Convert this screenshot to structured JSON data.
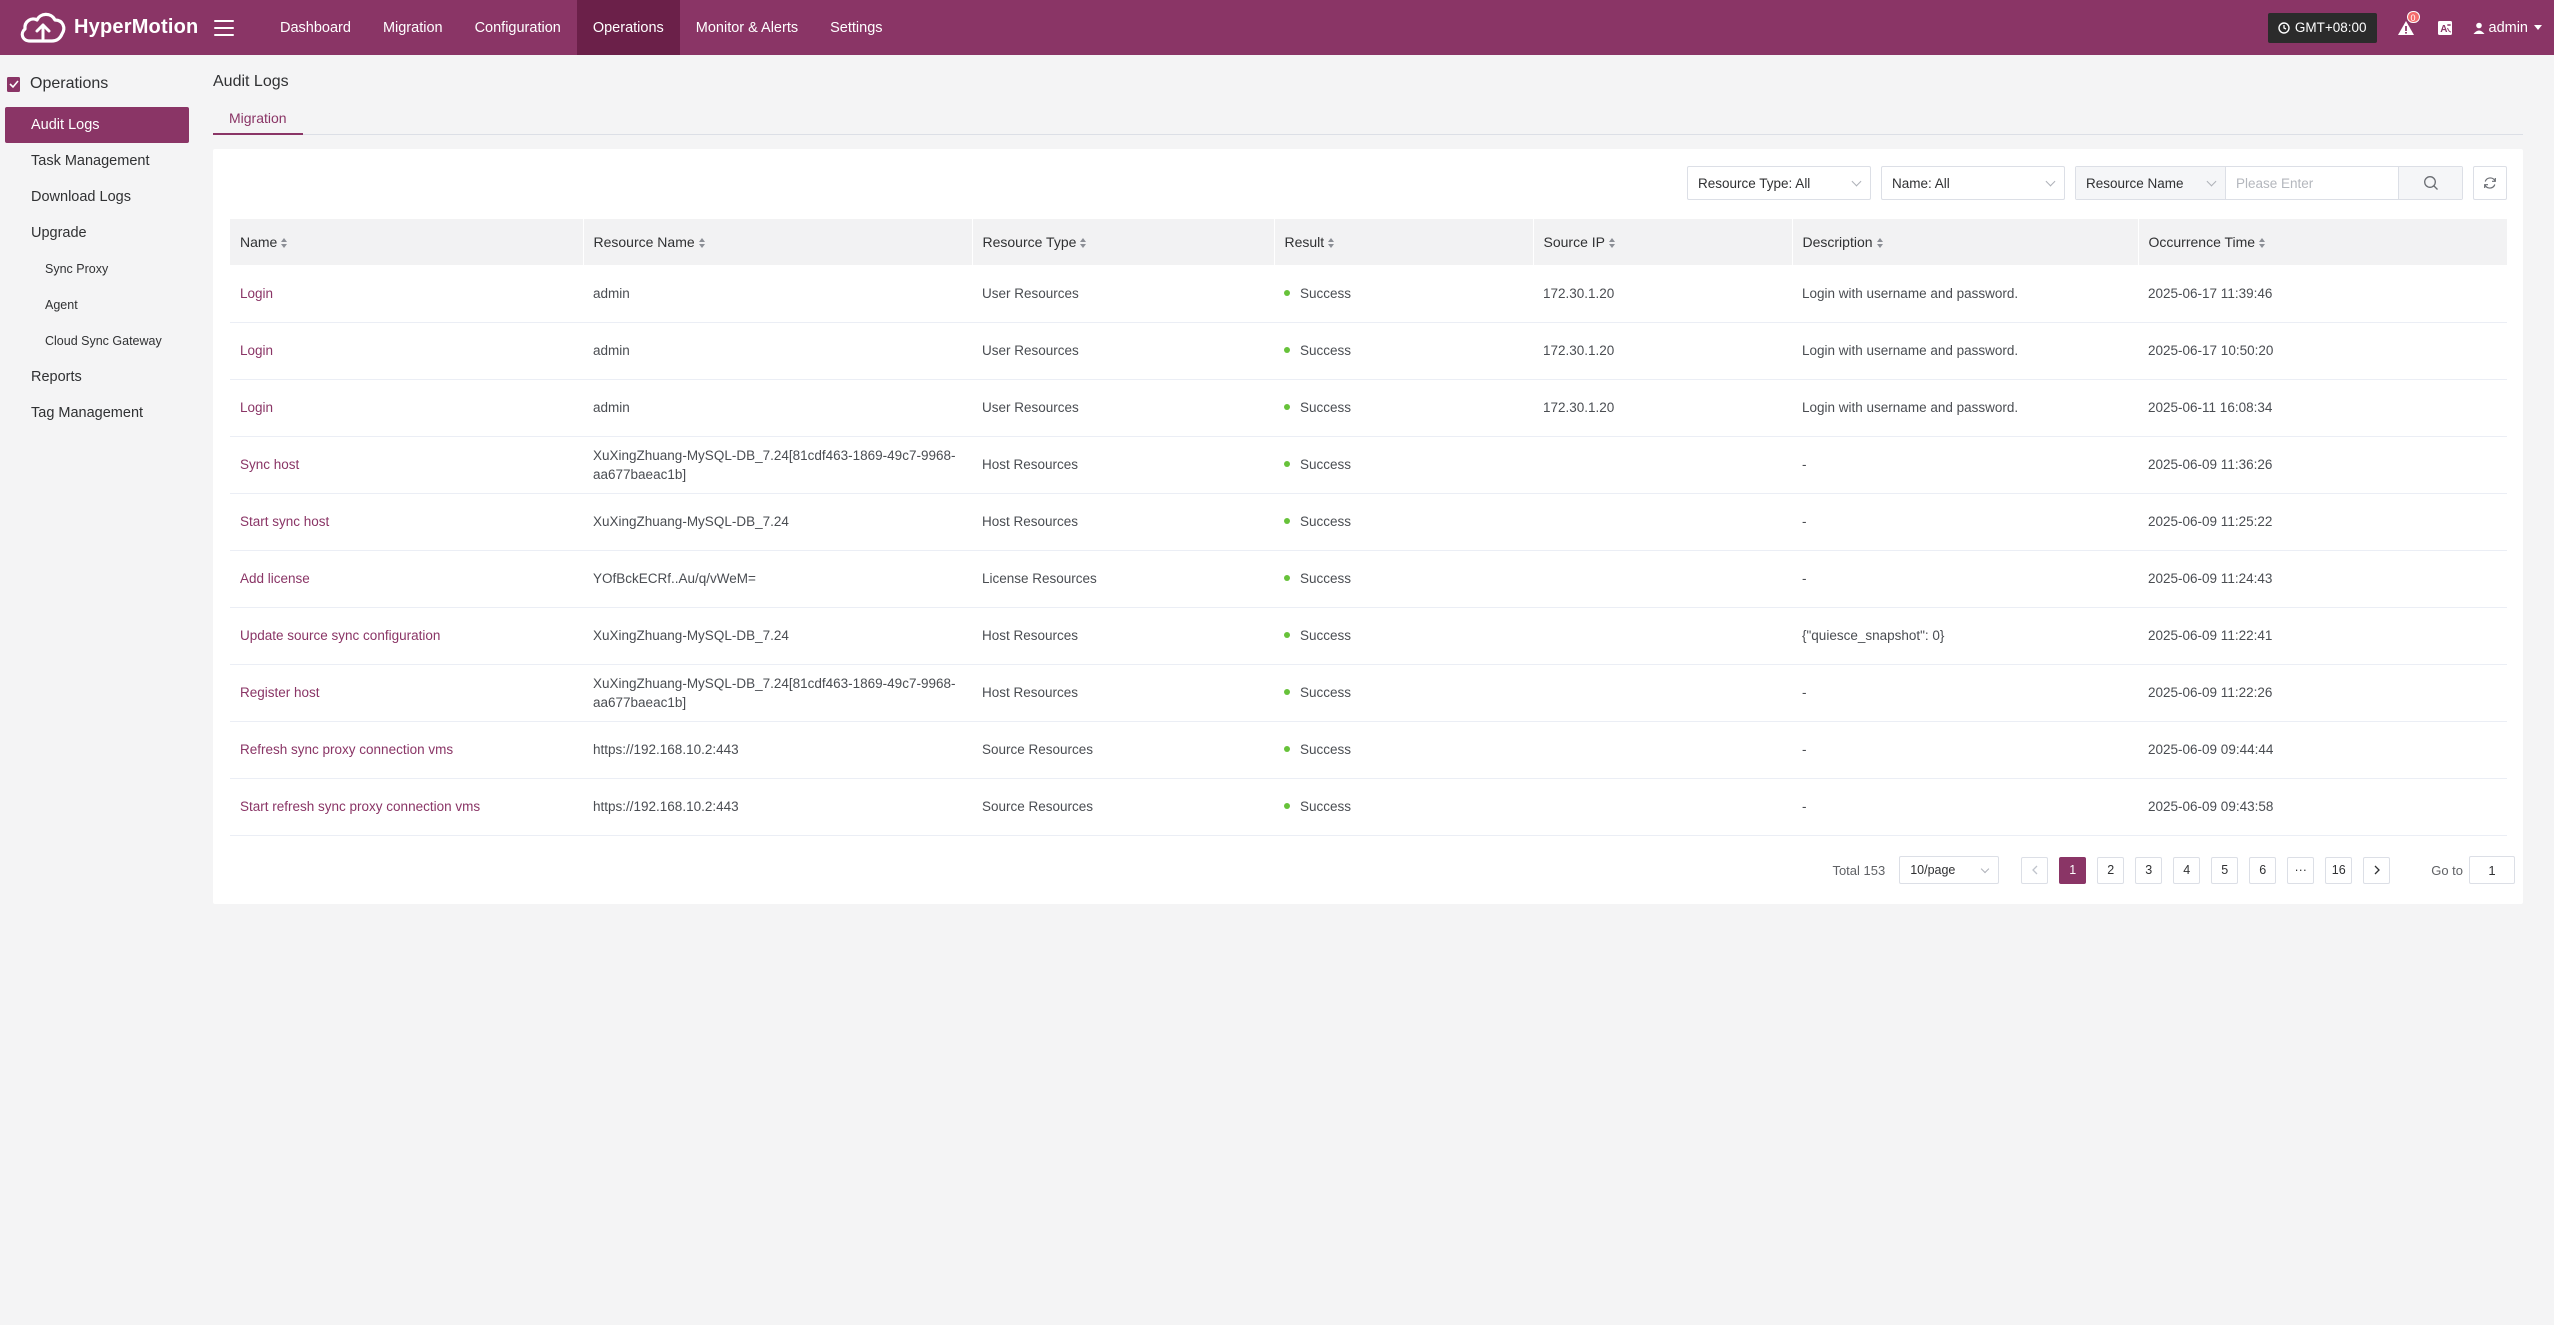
{
  "header": {
    "brand": "HyperMotion",
    "nav": [
      "Dashboard",
      "Migration",
      "Configuration",
      "Operations",
      "Monitor & Alerts",
      "Settings"
    ],
    "active_nav": "Operations",
    "timezone": "GMT+08:00",
    "alert_count": "0",
    "user": "admin",
    "colors": {
      "primary": "#8a3566",
      "active_nav": "#6b2049",
      "success": "#67c23a"
    }
  },
  "sidebar": {
    "title": "Operations",
    "items": [
      {
        "label": "Audit Logs",
        "level": 1,
        "active": true
      },
      {
        "label": "Task Management",
        "level": 1
      },
      {
        "label": "Download Logs",
        "level": 1
      },
      {
        "label": "Upgrade",
        "level": 1
      },
      {
        "label": "Sync Proxy",
        "level": 2
      },
      {
        "label": "Agent",
        "level": 2
      },
      {
        "label": "Cloud Sync Gateway",
        "level": 2
      },
      {
        "label": "Reports",
        "level": 1
      },
      {
        "label": "Tag Management",
        "level": 1
      }
    ]
  },
  "main": {
    "title": "Audit Logs",
    "tabs": [
      "Migration"
    ],
    "filters": {
      "resource_type": "Resource Type: All",
      "name": "Name: All",
      "search_field": "Resource Name",
      "search_placeholder": "Please Enter"
    },
    "table": {
      "columns": [
        "Name",
        "Resource Name",
        "Resource Type",
        "Result",
        "Source IP",
        "Description",
        "Occurrence Time"
      ],
      "rows": [
        [
          "Login",
          "admin",
          "User Resources",
          "Success",
          "172.30.1.20",
          "Login with username and password.",
          "2025-06-17 11:39:46"
        ],
        [
          "Login",
          "admin",
          "User Resources",
          "Success",
          "172.30.1.20",
          "Login with username and password.",
          "2025-06-17 10:50:20"
        ],
        [
          "Login",
          "admin",
          "User Resources",
          "Success",
          "172.30.1.20",
          "Login with username and password.",
          "2025-06-11 16:08:34"
        ],
        [
          "Sync host",
          "XuXingZhuang-MySQL-DB_7.24[81cdf463-1869-49c7-9968-aa677baeac1b]",
          "Host Resources",
          "Success",
          "",
          "-",
          "2025-06-09 11:36:26"
        ],
        [
          "Start sync host",
          "XuXingZhuang-MySQL-DB_7.24",
          "Host Resources",
          "Success",
          "",
          "-",
          "2025-06-09 11:25:22"
        ],
        [
          "Add license",
          "YOfBckECRf..Au/q/vWeM=",
          "License Resources",
          "Success",
          "",
          "-",
          "2025-06-09 11:24:43"
        ],
        [
          "Update source sync configuration",
          "XuXingZhuang-MySQL-DB_7.24",
          "Host Resources",
          "Success",
          "",
          "{\"quiesce_snapshot\": 0}",
          "2025-06-09 11:22:41"
        ],
        [
          "Register host",
          "XuXingZhuang-MySQL-DB_7.24[81cdf463-1869-49c7-9968-aa677baeac1b]",
          "Host Resources",
          "Success",
          "",
          "-",
          "2025-06-09 11:22:26"
        ],
        [
          "Refresh sync proxy connection vms",
          "https://192.168.10.2:443",
          "Source Resources",
          "Success",
          "",
          "-",
          "2025-06-09 09:44:44"
        ],
        [
          "Start refresh sync proxy connection vms",
          "https://192.168.10.2:443",
          "Source Resources",
          "Success",
          "",
          "-",
          "2025-06-09 09:43:58"
        ]
      ]
    },
    "pagination": {
      "total_label": "Total 153",
      "page_size": "10/page",
      "pages": [
        "1",
        "2",
        "3",
        "4",
        "5",
        "6",
        "···",
        "16"
      ],
      "current": "1",
      "goto_label": "Go to",
      "goto_value": "1"
    }
  }
}
